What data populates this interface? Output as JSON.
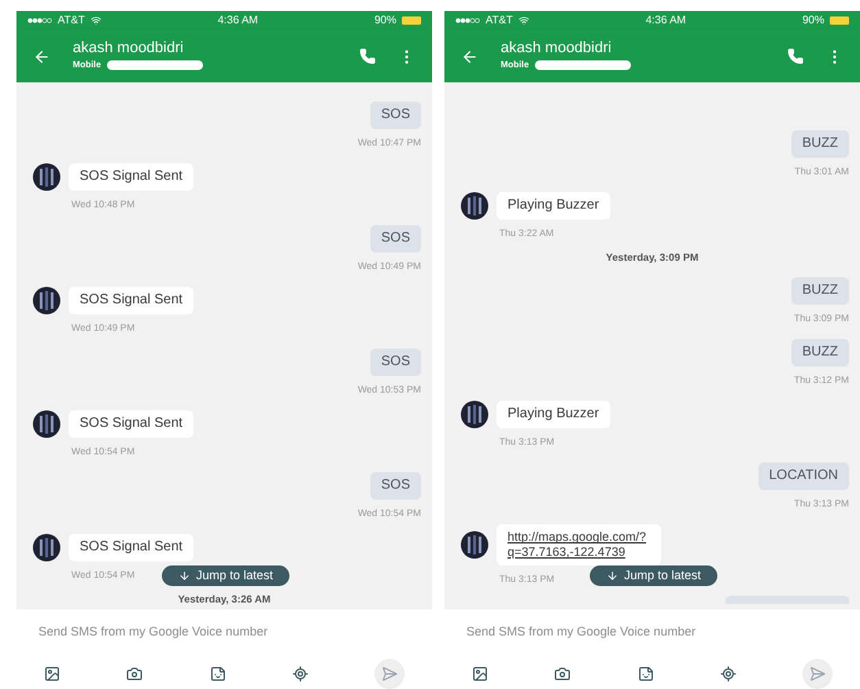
{
  "phones": [
    {
      "status_bar": {
        "carrier": "AT&T",
        "time": "4:36 AM",
        "battery": "90%"
      },
      "header": {
        "name": "akash moodbidri",
        "subtitle": "Mobile"
      },
      "messages": [
        {
          "kind": "sent",
          "text": "SOS",
          "time": "Wed 10:47 PM"
        },
        {
          "kind": "received",
          "text": "SOS Signal Sent",
          "time": "Wed 10:48 PM"
        },
        {
          "kind": "sent",
          "text": "SOS",
          "time": "Wed 10:49 PM"
        },
        {
          "kind": "received",
          "text": "SOS Signal Sent",
          "time": "Wed 10:49 PM"
        },
        {
          "kind": "sent",
          "text": "SOS",
          "time": "Wed 10:53 PM"
        },
        {
          "kind": "received",
          "text": "SOS Signal Sent",
          "time": "Wed 10:54 PM"
        },
        {
          "kind": "sent",
          "text": "SOS",
          "time": "Wed 10:54 PM"
        },
        {
          "kind": "received",
          "text": "SOS Signal Sent",
          "time": "Wed 10:54 PM"
        },
        {
          "kind": "divider",
          "text": "Yesterday, 3:26 AM"
        }
      ],
      "jump_button": "Jump to latest",
      "composer": {
        "placeholder": "Send SMS from my Google Voice number"
      }
    },
    {
      "status_bar": {
        "carrier": "AT&T",
        "time": "4:36 AM",
        "battery": "90%"
      },
      "header": {
        "name": "akash moodbidri",
        "subtitle": "Mobile"
      },
      "messages": [
        {
          "kind": "sent",
          "text": "BUZZ",
          "time": "Thu 3:01 AM"
        },
        {
          "kind": "received",
          "text": "Playing Buzzer",
          "time": "Thu 3:22 AM"
        },
        {
          "kind": "divider",
          "text": "Yesterday, 3:09 PM"
        },
        {
          "kind": "sent",
          "text": "BUZZ",
          "time": "Thu 3:09 PM"
        },
        {
          "kind": "sent",
          "text": "BUZZ",
          "time": "Thu 3:12 PM"
        },
        {
          "kind": "received",
          "text": "Playing Buzzer",
          "time": "Thu 3:13 PM"
        },
        {
          "kind": "sent",
          "text": "LOCATION",
          "time": "Thu 3:13 PM"
        },
        {
          "kind": "link",
          "text": "http://maps.google.com/?q=37.7163,-122.4739",
          "time": "Thu 3:13 PM"
        },
        {
          "kind": "partial"
        }
      ],
      "jump_button": "Jump to latest",
      "composer": {
        "placeholder": "Send SMS from my Google Voice number"
      }
    }
  ]
}
